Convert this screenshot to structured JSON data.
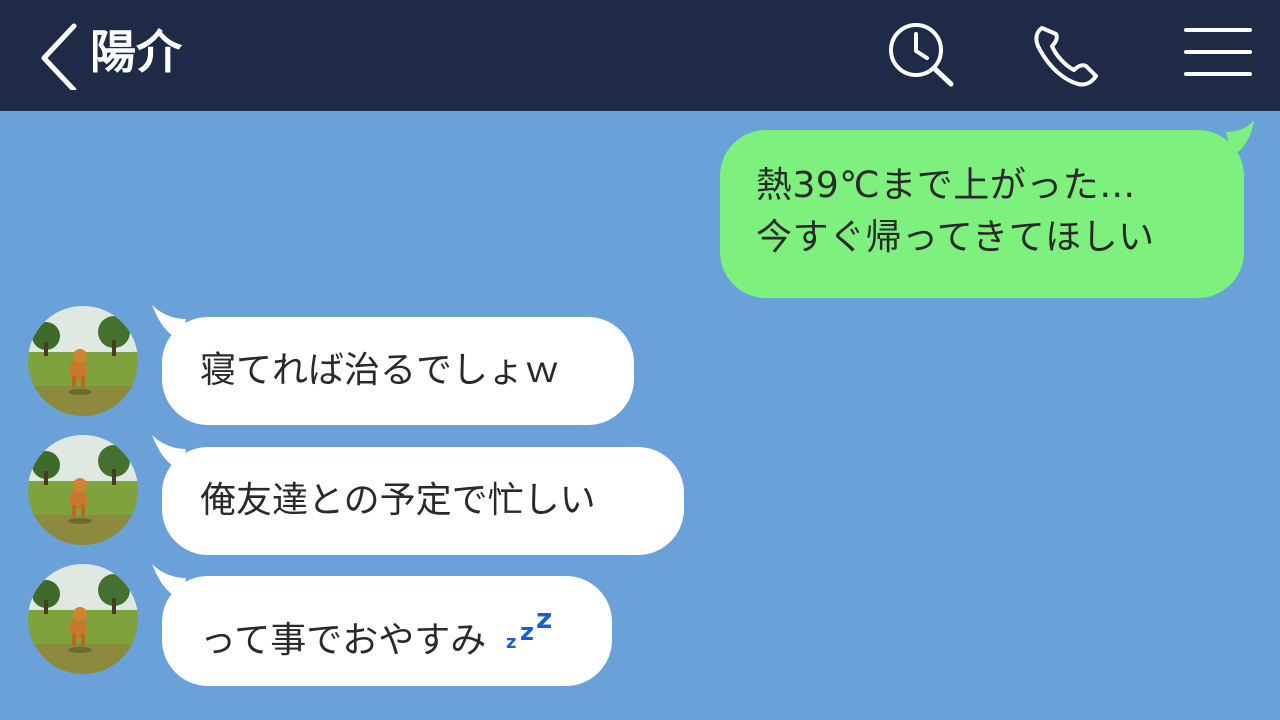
{
  "header": {
    "title": "陽介",
    "back_icon": "chevron-left-icon",
    "search_icon": "clock-search-icon",
    "call_icon": "phone-icon",
    "menu_icon": "hamburger-menu-icon",
    "background_color": "#1f2b46"
  },
  "chat": {
    "background_color": "#6aa1d8",
    "messages": [
      {
        "sender": "me",
        "lines": [
          "熱39℃まで上がった…",
          "今すぐ帰ってきてほしい"
        ],
        "bubble_color": "#7ef07e"
      },
      {
        "sender": "陽介",
        "avatar_icon": "shiba-dog-field-avatar",
        "text": "寝てれば治るでしょｗ",
        "bubble_color": "#ffffff"
      },
      {
        "sender": "陽介",
        "avatar_icon": "shiba-dog-field-avatar",
        "text": "俺友達との予定で忙しい",
        "bubble_color": "#ffffff"
      },
      {
        "sender": "陽介",
        "avatar_icon": "shiba-dog-field-avatar",
        "text": "って事でおやすみ",
        "emoji_icon": "sleeping-zzz-icon",
        "bubble_color": "#ffffff"
      }
    ]
  }
}
